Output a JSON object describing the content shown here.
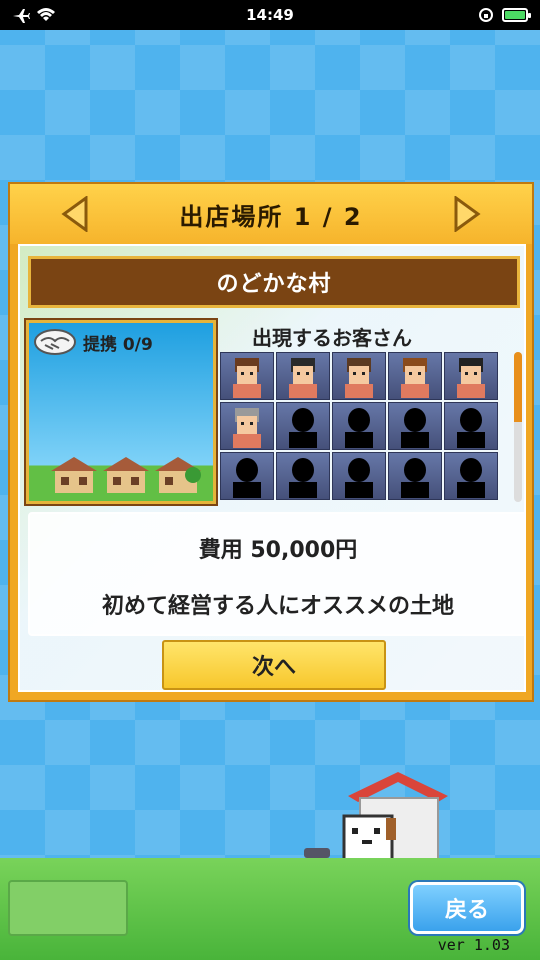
{
  "status_bar": {
    "time": "14:49"
  },
  "panel": {
    "title": "出店場所 1 / 2",
    "location_name": "のどかな村",
    "partner_label": "提携 0/9",
    "customers_title": "出現するお客さん",
    "cost_text": "費用 50,000円",
    "description": "初めて経営する人にオススメの土地",
    "next_button": "次へ"
  },
  "customers": [
    {
      "type": "face",
      "hair": "#6a3b1f"
    },
    {
      "type": "face",
      "hair": "#2a2a2a"
    },
    {
      "type": "face",
      "hair": "#5b3a22"
    },
    {
      "type": "face",
      "hair": "#8a4b1d"
    },
    {
      "type": "face",
      "hair": "#222222"
    },
    {
      "type": "face",
      "hair": "#9a9a9a"
    },
    {
      "type": "silhouette"
    },
    {
      "type": "silhouette"
    },
    {
      "type": "silhouette"
    },
    {
      "type": "silhouette"
    },
    {
      "type": "silhouette"
    },
    {
      "type": "silhouette"
    },
    {
      "type": "silhouette"
    },
    {
      "type": "silhouette"
    },
    {
      "type": "silhouette"
    }
  ],
  "footer": {
    "back_button": "戻る",
    "version": "ver 1.03"
  },
  "colors": {
    "background": "#4fb3ee",
    "panel_orange": "#f0a723",
    "village_bar": "#7a4413",
    "button_yellow": "#f7c72c",
    "back_button": "#3aa2ec",
    "grass": "#49b43a"
  }
}
